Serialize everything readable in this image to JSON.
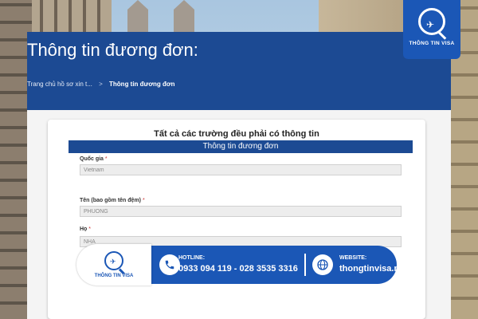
{
  "page": {
    "title": "Thông tin đương đơn:",
    "breadcrumb": {
      "home": "Trang chủ hồ sơ xin t...",
      "separator": ">",
      "current": "Thông tin đương đơn"
    }
  },
  "form": {
    "heading": "Tất cả các trường đều phải có thông tin",
    "section_title": "Thông tin đương đơn",
    "required_mark": "*",
    "fields": [
      {
        "label": "Quốc gia",
        "value": "Vietnam"
      },
      {
        "label": "Tên (bao gồm tên đệm)",
        "value": "PHUONG"
      },
      {
        "label": "Họ",
        "value": "NHA"
      }
    ]
  },
  "logo": {
    "text": "THÔNG TIN VISA"
  },
  "banner": {
    "logo_text": "THÔNG TIN VISA",
    "hotline_label": "HOTLINE:",
    "hotline_value": "0933 094 119 - 028 3535 3316",
    "website_label": "WEBSITE:",
    "website_value": "thongtinvisa.net"
  },
  "colors": {
    "brand_blue": "#1b57b6",
    "header_blue": "#1c4a93"
  },
  "icons": {
    "phone": "phone-icon",
    "globe": "globe-icon",
    "plane": "plane-icon"
  }
}
